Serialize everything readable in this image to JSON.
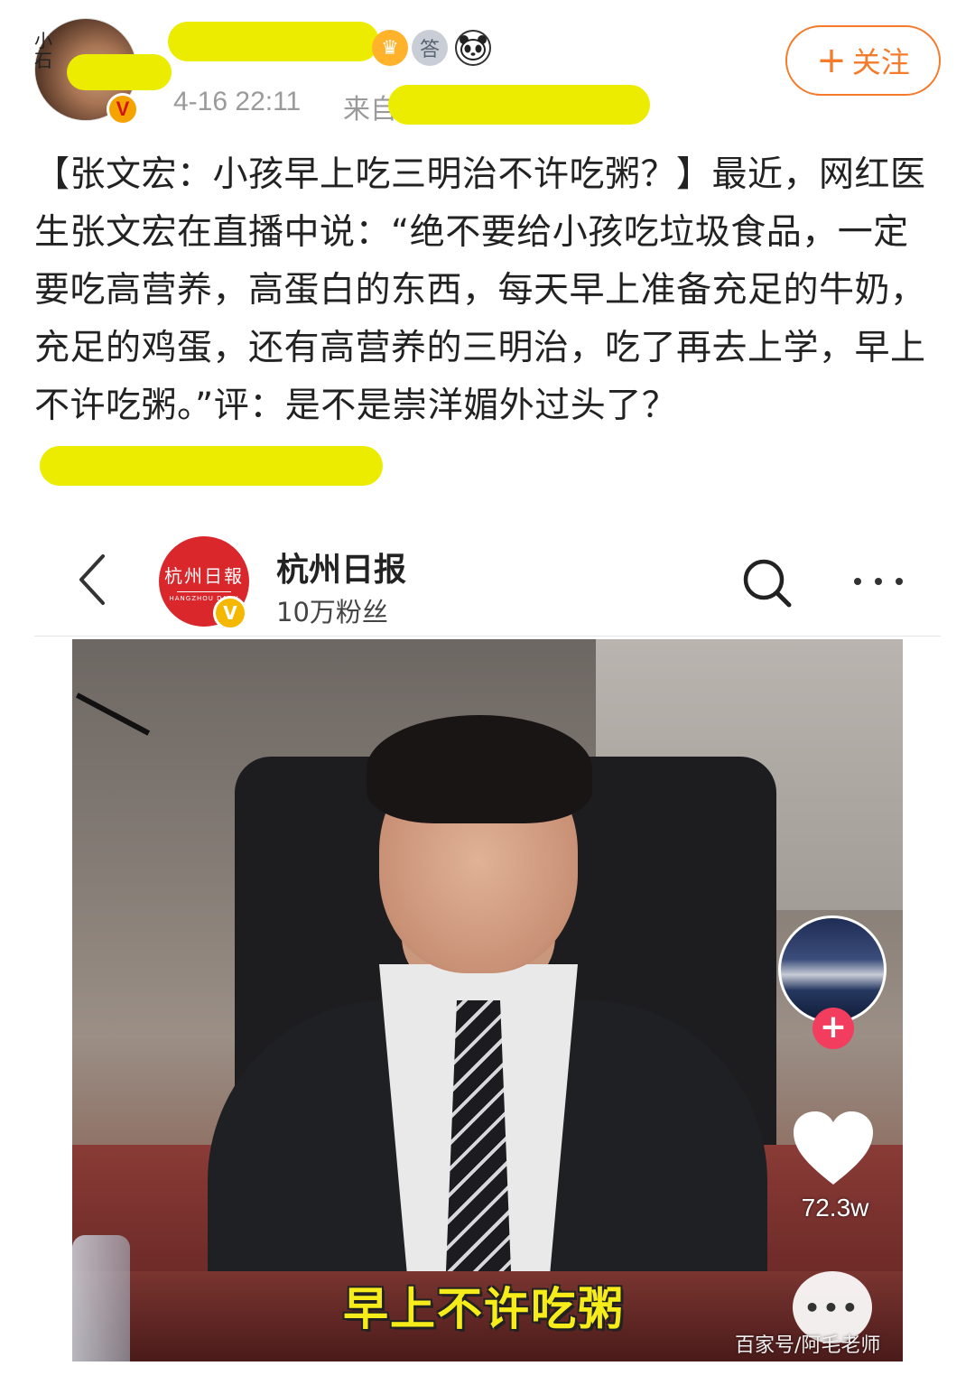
{
  "post": {
    "avatar_text": "小石",
    "verified_mark": "V",
    "time": "4-16 22:11",
    "source_label": "来自",
    "follow_plus": "+",
    "follow_label": "关注",
    "badges": {
      "medal": "答"
    },
    "text": "【张文宏：小孩早上吃三明治不许吃粥？】最近，网红医生张文宏在直播中说：“绝不要给小孩吃垃圾食品，一定要吃高营养，高蛋白的东西，每天早上准备充足的牛奶，充足的鸡蛋，还有高营养的三明治，吃了再去上学，早上不许吃粥。”评：是不是崇洋媚外过头了？",
    "redaction_color": "#ecec00",
    "accent_color": "#f57a2a"
  },
  "embed": {
    "account_name": "杭州日报",
    "fans": "10万粉丝",
    "logo_cn": "杭州日報",
    "logo_en": "HANGZHOU DAILY",
    "verified_mark": "V",
    "video": {
      "subtitle": "早上不许吃粥",
      "like_count": "72.3w",
      "watermark": "百家号/阿毛老师",
      "follow_plus": "+",
      "comment_dots": "•••"
    }
  }
}
